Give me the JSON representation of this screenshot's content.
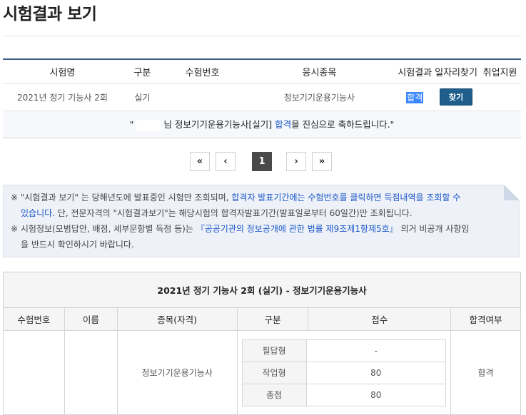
{
  "page": {
    "title": "시험결과 보기"
  },
  "result_table": {
    "headers": [
      "시험명",
      "구분",
      "수험번호",
      "응시종목",
      "시험결과",
      "일자리찾기",
      "취업지원"
    ],
    "row": {
      "exam_name": "2021년 정기 기능사 2회",
      "type": "실기",
      "exam_number": "",
      "subject": "정보기기운용기능사",
      "result": "합격",
      "find_button": "찾기",
      "support": ""
    },
    "congrats": {
      "open_quote": "\"",
      "suffix_before": "님 정보기기운용기능사[실기] ",
      "pass_word": "합격",
      "suffix_after": "을 진심으로 축하드립니다.\""
    }
  },
  "pagination": {
    "first": "«",
    "prev": "‹",
    "current": "1",
    "next": "›",
    "last": "»"
  },
  "notice": {
    "line1_a": "※ \"시험결과 보기\" 는 당해년도에 발표중인 시험만 조회되며, ",
    "line1_b": "합격자 발표기간에는 수험번호를 클릭하면 득점내역을 조회할 수",
    "line2_a": "있습니다.",
    "line2_b": " 단, 전문자격의 \"시험결과보기\"는 해당시험의 합격자발표기간(발표일로부터 60일간)만 조회됩니다.",
    "line3_a": "※ 시험정보(모범답안, 배점, 세부문항별 득점 등)는 ",
    "line3_b": "『공공기관의 정보공개에 관한 법률 제9조제1항제5호』",
    "line3_c": " 의거 비공개 사항임",
    "line4": "을 반드시 확인하시기 바랍니다."
  },
  "detail": {
    "caption": "2021년 정기 기능사 2회 (실기) - 정보기기운용기능사",
    "headers": [
      "수험번호",
      "이름",
      "종목(자격)",
      "구분",
      "점수",
      "합격여부"
    ],
    "exam_number": "",
    "name": "",
    "subject": "정보기기운용기능사",
    "scores": [
      {
        "label": "필답형",
        "value": "-"
      },
      {
        "label": "작업형",
        "value": "80"
      },
      {
        "label": "총점",
        "value": "80"
      }
    ],
    "pass_status": "합격"
  },
  "colors": {
    "accent": "#3b5a86",
    "button": "#1f5d8a",
    "highlight": "#3a86ff",
    "link": "#1a56c8"
  }
}
